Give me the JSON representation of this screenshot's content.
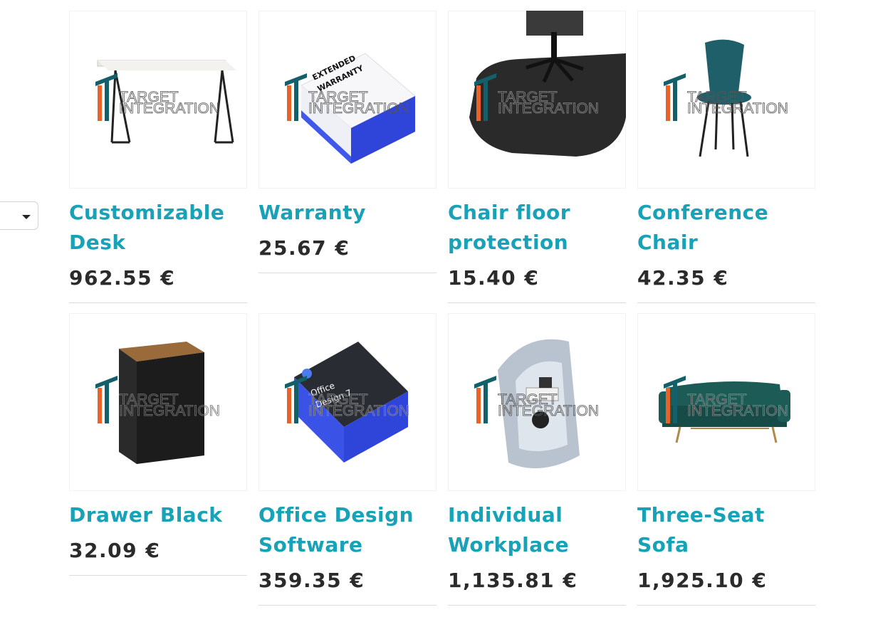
{
  "currency": "€",
  "colors": {
    "name": "#17a2b8",
    "price": "#2b2b2b",
    "watermark_orange": "#e8622a",
    "watermark_teal": "#14606a"
  },
  "watermark": {
    "line1": "TARGET",
    "line2": "INTEGRATION"
  },
  "products": [
    {
      "name": "Customizable Desk",
      "price": "962.55 €",
      "icon": "desk-image"
    },
    {
      "name": "Warranty",
      "price": "25.67 €",
      "icon": "warranty-box-image",
      "image_text": [
        "EXTENDED",
        "WARRANTY"
      ]
    },
    {
      "name": "Chair floor protection",
      "price": "15.40 €",
      "icon": "floor-mat-image"
    },
    {
      "name": "Conference Chair",
      "price": "42.35 €",
      "icon": "chair-image"
    },
    {
      "name": "Drawer Black",
      "price": "32.09 €",
      "icon": "drawer-image"
    },
    {
      "name": "Office Design Software",
      "price": "359.35 €",
      "icon": "software-box-image",
      "image_text": [
        "Office",
        "Design 7"
      ]
    },
    {
      "name": "Individual Workplace",
      "price": "1,135.81 €",
      "icon": "workplace-pod-image"
    },
    {
      "name": "Three-Seat Sofa",
      "price": "1,925.10 €",
      "icon": "sofa-image"
    }
  ]
}
